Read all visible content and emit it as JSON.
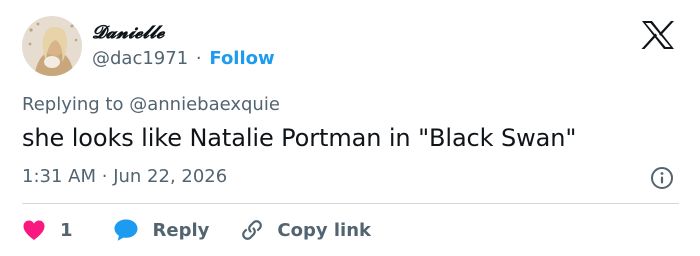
{
  "author": {
    "display_name": "𝓓𝓪𝓷𝓲𝓮𝓵𝓵𝓮",
    "handle": "@dac1971",
    "separator": "·",
    "follow_label": "Follow"
  },
  "reply_context": {
    "prefix": "Replying to",
    "mention": "@anniebaexquie"
  },
  "tweet": {
    "text": "she looks like Natalie Portman in \"Black Swan\"",
    "time": "1:31 AM",
    "separator": "·",
    "date": "Jun 22, 2026"
  },
  "actions": {
    "like_count": "1",
    "reply_label": "Reply",
    "copy_label": "Copy link"
  },
  "icons": {
    "logo": "x-logo-icon",
    "info": "info-icon",
    "like": "heart-icon",
    "reply": "speech-bubble-icon",
    "copy": "link-icon"
  },
  "colors": {
    "accent": "#1d9bf0",
    "like": "#f91880",
    "muted_text": "#536471",
    "text": "#0f1419",
    "divider": "#cfd9de"
  }
}
